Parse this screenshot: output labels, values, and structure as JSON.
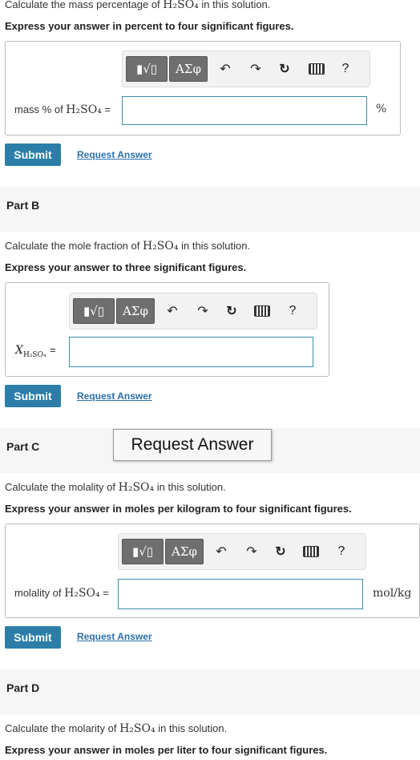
{
  "partA": {
    "question_prefix": "Calculate the mass percentage of ",
    "formula": "H₂SO₄",
    "question_suffix": " in this solution.",
    "instruction": "Express your answer in percent to four significant figures.",
    "label_prefix": "mass % of ",
    "label_formula": "H₂SO₄",
    "equals": "=",
    "unit": "%",
    "submit": "Submit",
    "request": "Request Answer"
  },
  "partB": {
    "title": "Part B",
    "question_prefix": "Calculate the mole fraction of ",
    "formula": "H₂SO₄",
    "question_suffix": " in this solution.",
    "instruction": "Express your answer to three significant figures.",
    "label_var": "X",
    "label_sub": "H₂SO₄",
    "equals": "=",
    "submit": "Submit",
    "request": "Request Answer"
  },
  "partC": {
    "title": "Part C",
    "question_prefix": "Calculate the molality of ",
    "formula": "H₂SO₄",
    "question_suffix": " in this solution.",
    "instruction": "Express your answer in moles per kilogram to four significant figures.",
    "label_prefix": "molality of ",
    "label_formula": "H₂SO₄",
    "equals": "=",
    "unit": "mol/kg",
    "submit": "Submit",
    "request": "Request Answer"
  },
  "partD": {
    "title": "Part D",
    "question_prefix": "Calculate the molarity of ",
    "formula": "H₂SO₄",
    "question_suffix": " in this solution.",
    "instruction": "Express your answer in moles per liter to four significant figures."
  },
  "toolbar": {
    "templates_label": "▮√▯",
    "greek_label": "ΑΣφ",
    "undo": "↶",
    "redo": "↷",
    "reset": "↻",
    "help": "?"
  },
  "tooltip": "Request Answer"
}
